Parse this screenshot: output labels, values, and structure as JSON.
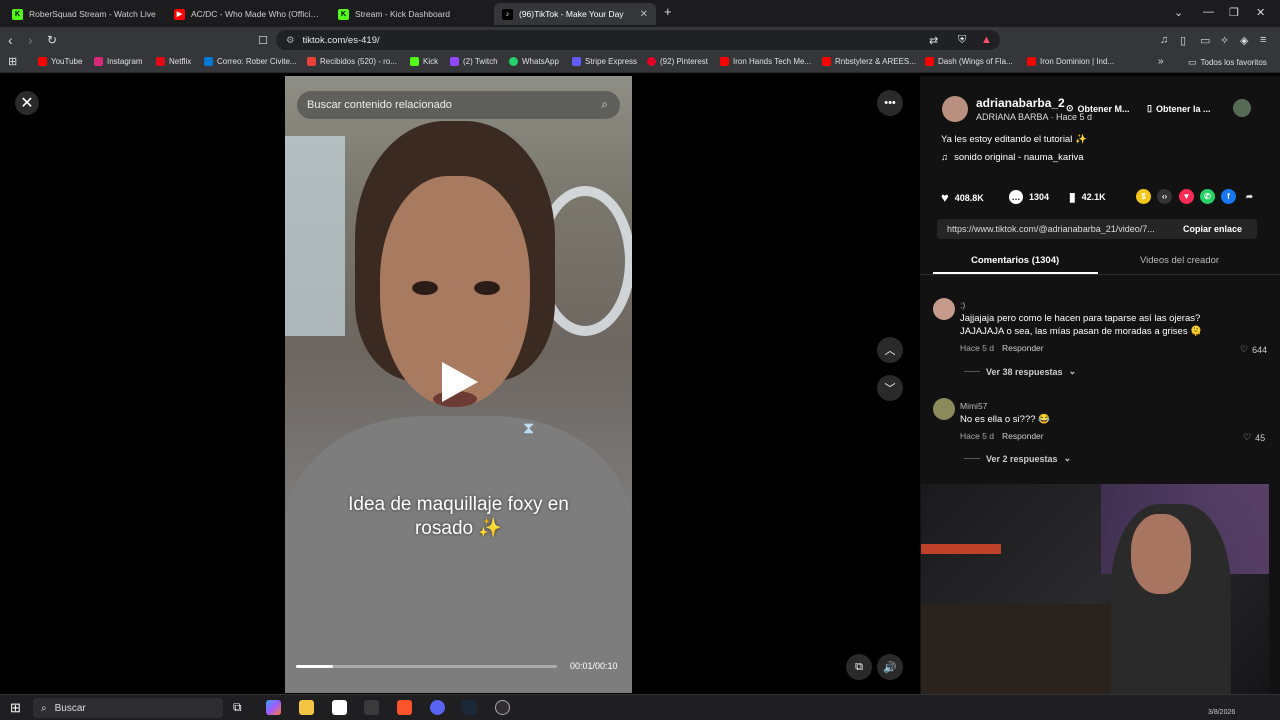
{
  "browser": {
    "tabs": [
      {
        "title": "RoberSquad Stream - Watch Live",
        "color": "#53fc18",
        "icon": "K"
      },
      {
        "title": "AC/DC - Who Made Who (Official HD",
        "color": "#ff0000",
        "icon": "▶"
      },
      {
        "title": "Stream - Kick Dashboard",
        "color": "#53fc18",
        "icon": "K"
      },
      {
        "title": "(96)TikTok - Make Your Day",
        "color": "#ffffff",
        "icon": "♪"
      }
    ],
    "new_tab_label": "+",
    "url": "tiktok.com/es-419/",
    "bookmarks": [
      {
        "label": "YouTube",
        "color": "#ff0000"
      },
      {
        "label": "Instagram",
        "color": "#d62976"
      },
      {
        "label": "Netflix",
        "color": "#e50914"
      },
      {
        "label": "Correo: Rober Civite...",
        "color": "#0078d4"
      },
      {
        "label": "Recibidos (520) - ro...",
        "color": "#ea4335"
      },
      {
        "label": "Kick",
        "color": "#53fc18"
      },
      {
        "label": "(2) Twitch",
        "color": "#9146ff"
      },
      {
        "label": "WhatsApp",
        "color": "#25d366"
      },
      {
        "label": "Stripe Express",
        "color": "#635bff"
      },
      {
        "label": "(92) Pinterest",
        "color": "#e60023"
      },
      {
        "label": "Iron Hands Tech Me...",
        "color": "#ff0000"
      },
      {
        "label": "Rnbstylerz & AREES...",
        "color": "#ff0000"
      },
      {
        "label": "Dash (Wings of Fla...",
        "color": "#ff0000"
      },
      {
        "label": "Iron Dominion | Ind...",
        "color": "#ff0000"
      }
    ],
    "bookmarks_more": "»",
    "all_favorites": "Todos los favoritos"
  },
  "video": {
    "search_placeholder": "Buscar contenido relacionado",
    "caption_line1": "Idea de maquillaje foxy en",
    "caption_line2": "rosado ✨",
    "timecode": "00:01/00:10",
    "progress": 0.14
  },
  "creator": {
    "username": "adrianabarba_2",
    "display": "ADRIANA BARBA · Hace 5 d",
    "get_app": "Obtener M...",
    "get_app2": "Obtener la ...",
    "description": "Ya les estoy editando el tutorial ✨",
    "music": "sonido original - nauma_kariva",
    "likes": "408.8K",
    "comments": "1304",
    "saves": "42.1K",
    "link": "https://www.tiktok.com/@adrianabarba_21/video/7...",
    "copy_link": "Copiar enlace",
    "tab_comments": "Comentarios (1304)",
    "tab_videos": "Videos del creador"
  },
  "comments": [
    {
      "user": ":)",
      "text": "Jajjajaja pero como le hacen para taparse así las ojeras? JAJAJAJA o sea, las mías pasan de moradas a grises 🫠",
      "time": "Hace 5 d",
      "reply": "Responder",
      "likes": "644",
      "replies": "Ver 38 respuestas"
    },
    {
      "user": "Mimi57",
      "text": "No es ella o si??? 😂",
      "time": "Hace 5 d",
      "reply": "Responder",
      "likes": "45",
      "replies": "Ver 2 respuestas"
    }
  ],
  "taskbar": {
    "search": "Buscar",
    "clock": "3/8/2026"
  }
}
